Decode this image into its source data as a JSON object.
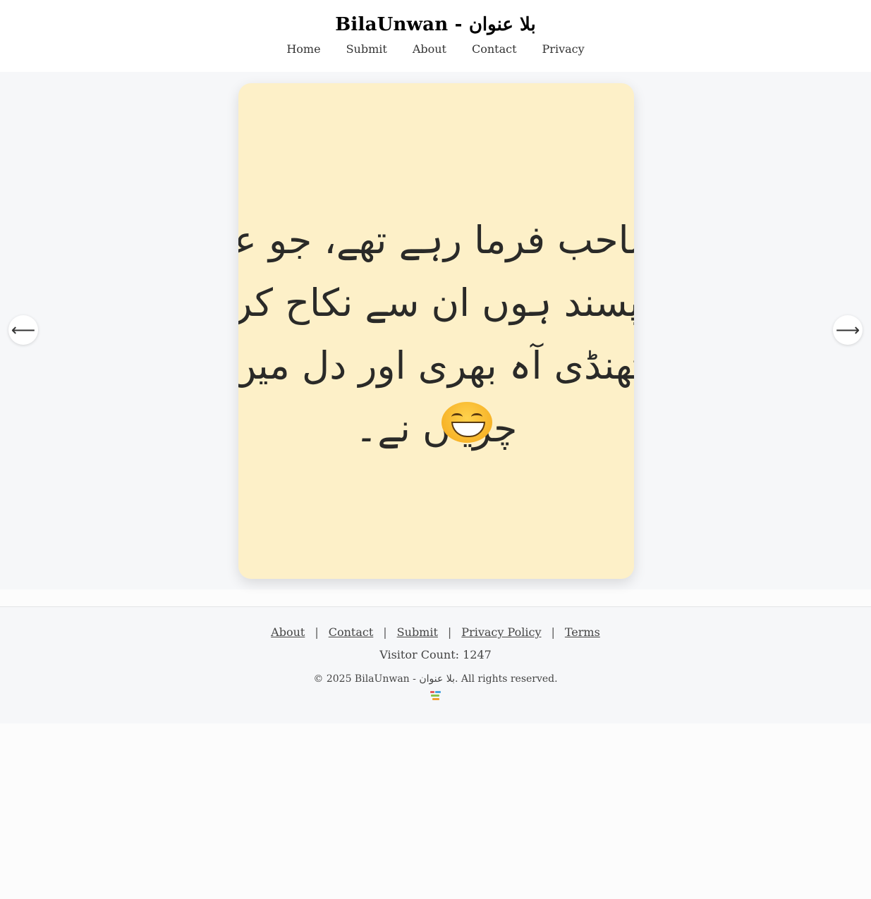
{
  "site": {
    "title": "BilaUnwan - بلا عنوان"
  },
  "nav": {
    "items": [
      {
        "label": "Home"
      },
      {
        "label": "Submit"
      },
      {
        "label": "About"
      },
      {
        "label": "Contact"
      },
      {
        "label": "Privacy"
      }
    ]
  },
  "post": {
    "lines": [
      "صاحب فرما رہے تھے، جو عورت",
      "ناپسند ہوں ان سے نکاح کر لو",
      "ٹھنڈی آہ بھری اور دل میں",
      "چڑیاں نے۔"
    ],
    "emoji": "laughing-face-emoji"
  },
  "carousel": {
    "prev_symbol": "⟵",
    "next_symbol": "⟶"
  },
  "footer": {
    "links": [
      {
        "label": "About"
      },
      {
        "label": "Contact"
      },
      {
        "label": "Submit"
      },
      {
        "label": "Privacy Policy"
      },
      {
        "label": "Terms"
      }
    ],
    "separator": "|",
    "visitor_count": "Visitor Count: 1247",
    "copyright": "© 2025 BilaUnwan - بلا عنوان. All rights reserved."
  },
  "colors": {
    "card_bg": "#fdf0c8",
    "page_bg": "#f6f7f9"
  }
}
